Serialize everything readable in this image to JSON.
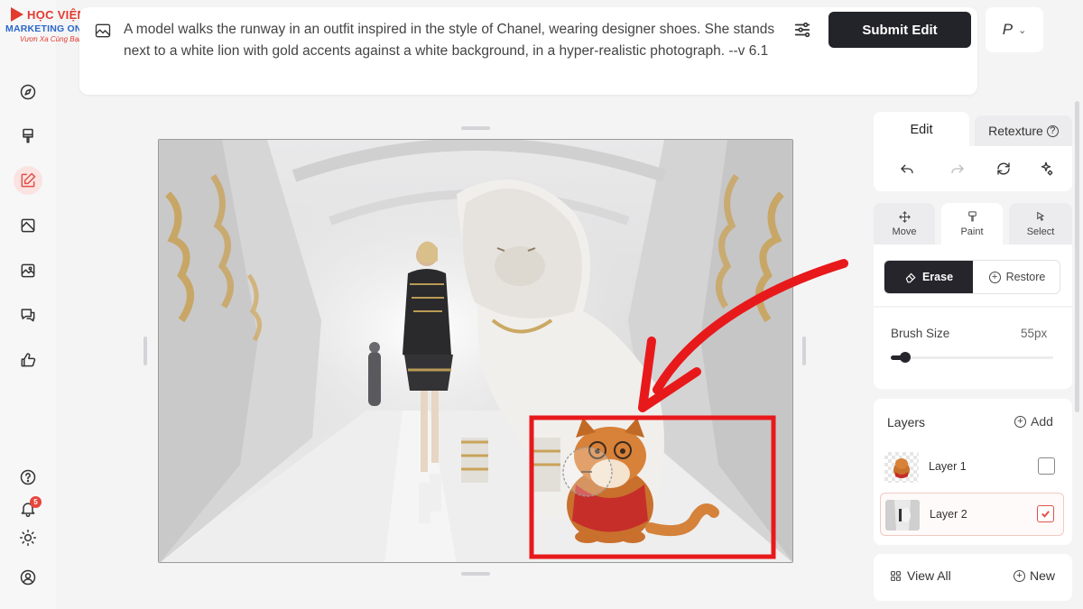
{
  "brand": {
    "line1": "HỌC VIỆN",
    "line2": "MARKETING ONLINE",
    "line3": "Vươn Xa Cùng Bạn",
    "partial_behind": "M"
  },
  "prompt": {
    "text": "A model walks the runway in an outfit inspired in the style of Chanel, wearing designer shoes. She stands next to a white lion with gold accents against a white background, in a hyper-realistic photograph. --v 6.1",
    "submit_label": "Submit Edit",
    "profile_letter": "P"
  },
  "sidebar": {
    "notification_count": "5",
    "items": [
      "compass-icon",
      "paintbrush-icon",
      "edit-icon",
      "layers-book-icon",
      "image-icon",
      "chat-icon",
      "thumbs-up-icon"
    ],
    "bottom": [
      "help-icon",
      "bell-icon",
      "sun-icon",
      "account-icon"
    ]
  },
  "panel": {
    "tabs": [
      {
        "label": "Edit",
        "active": true
      },
      {
        "label": "Retexture",
        "active": false
      }
    ],
    "modes": [
      {
        "label": "Move",
        "active": false
      },
      {
        "label": "Paint",
        "active": true
      },
      {
        "label": "Select",
        "active": false
      }
    ],
    "erase_label": "Erase",
    "restore_label": "Restore",
    "brush_label": "Brush Size",
    "brush_value": "55px",
    "brush_fraction": 0.08,
    "layers_title": "Layers",
    "add_label": "Add",
    "layers": [
      {
        "name": "Layer 1",
        "checked": false
      },
      {
        "name": "Layer 2",
        "checked": true
      }
    ],
    "view_all_label": "View All",
    "new_label": "New"
  },
  "colors": {
    "accent": "#e0524a",
    "dark_button": "#23232a",
    "annotation_red": "#e8191b"
  }
}
